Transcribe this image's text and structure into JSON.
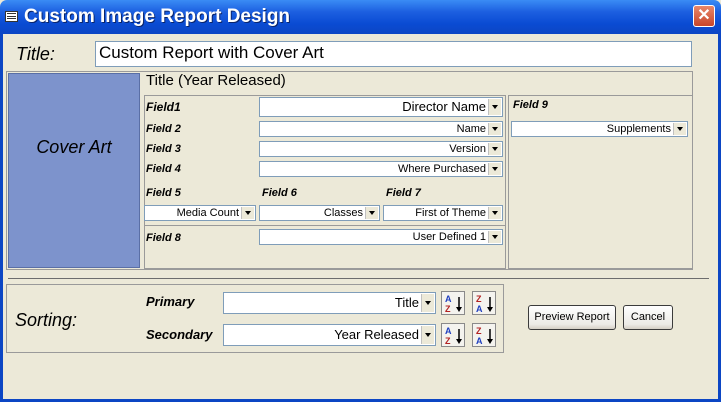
{
  "window": {
    "title": "Custom Image Report Design",
    "close_glyph": "✕"
  },
  "title_field": {
    "label": "Title:",
    "value": "Custom Report with Cover Art"
  },
  "cover_art": {
    "label": "Cover Art"
  },
  "layout": {
    "subtitle": "Title (Year Released)",
    "fields": [
      {
        "label": "Field1",
        "value": "Director Name"
      },
      {
        "label": "Field 2",
        "value": "Name"
      },
      {
        "label": "Field 3",
        "value": "Version"
      },
      {
        "label": "Field 4",
        "value": "Where Purchased"
      },
      {
        "label": "Field 5",
        "value": "Media Count"
      },
      {
        "label": "Field 6",
        "value": "Classes"
      },
      {
        "label": "Field 7",
        "value": "First of Theme"
      },
      {
        "label": "Field 8",
        "value": "User Defined 1"
      },
      {
        "label": "Field 9",
        "value": "Supplements"
      }
    ]
  },
  "sorting": {
    "label": "Sorting:",
    "primary": {
      "label": "Primary",
      "value": "Title"
    },
    "secondary": {
      "label": "Secondary",
      "value": "Year Released"
    },
    "az_icon": "sort-ascending-icon",
    "za_icon": "sort-descending-icon"
  },
  "buttons": {
    "preview": "Preview Report",
    "cancel": "Cancel"
  },
  "colors": {
    "titlebar": "#0C46C4",
    "cover_art": "#7D93CC",
    "dialog_bg": "#ECE9D8"
  }
}
